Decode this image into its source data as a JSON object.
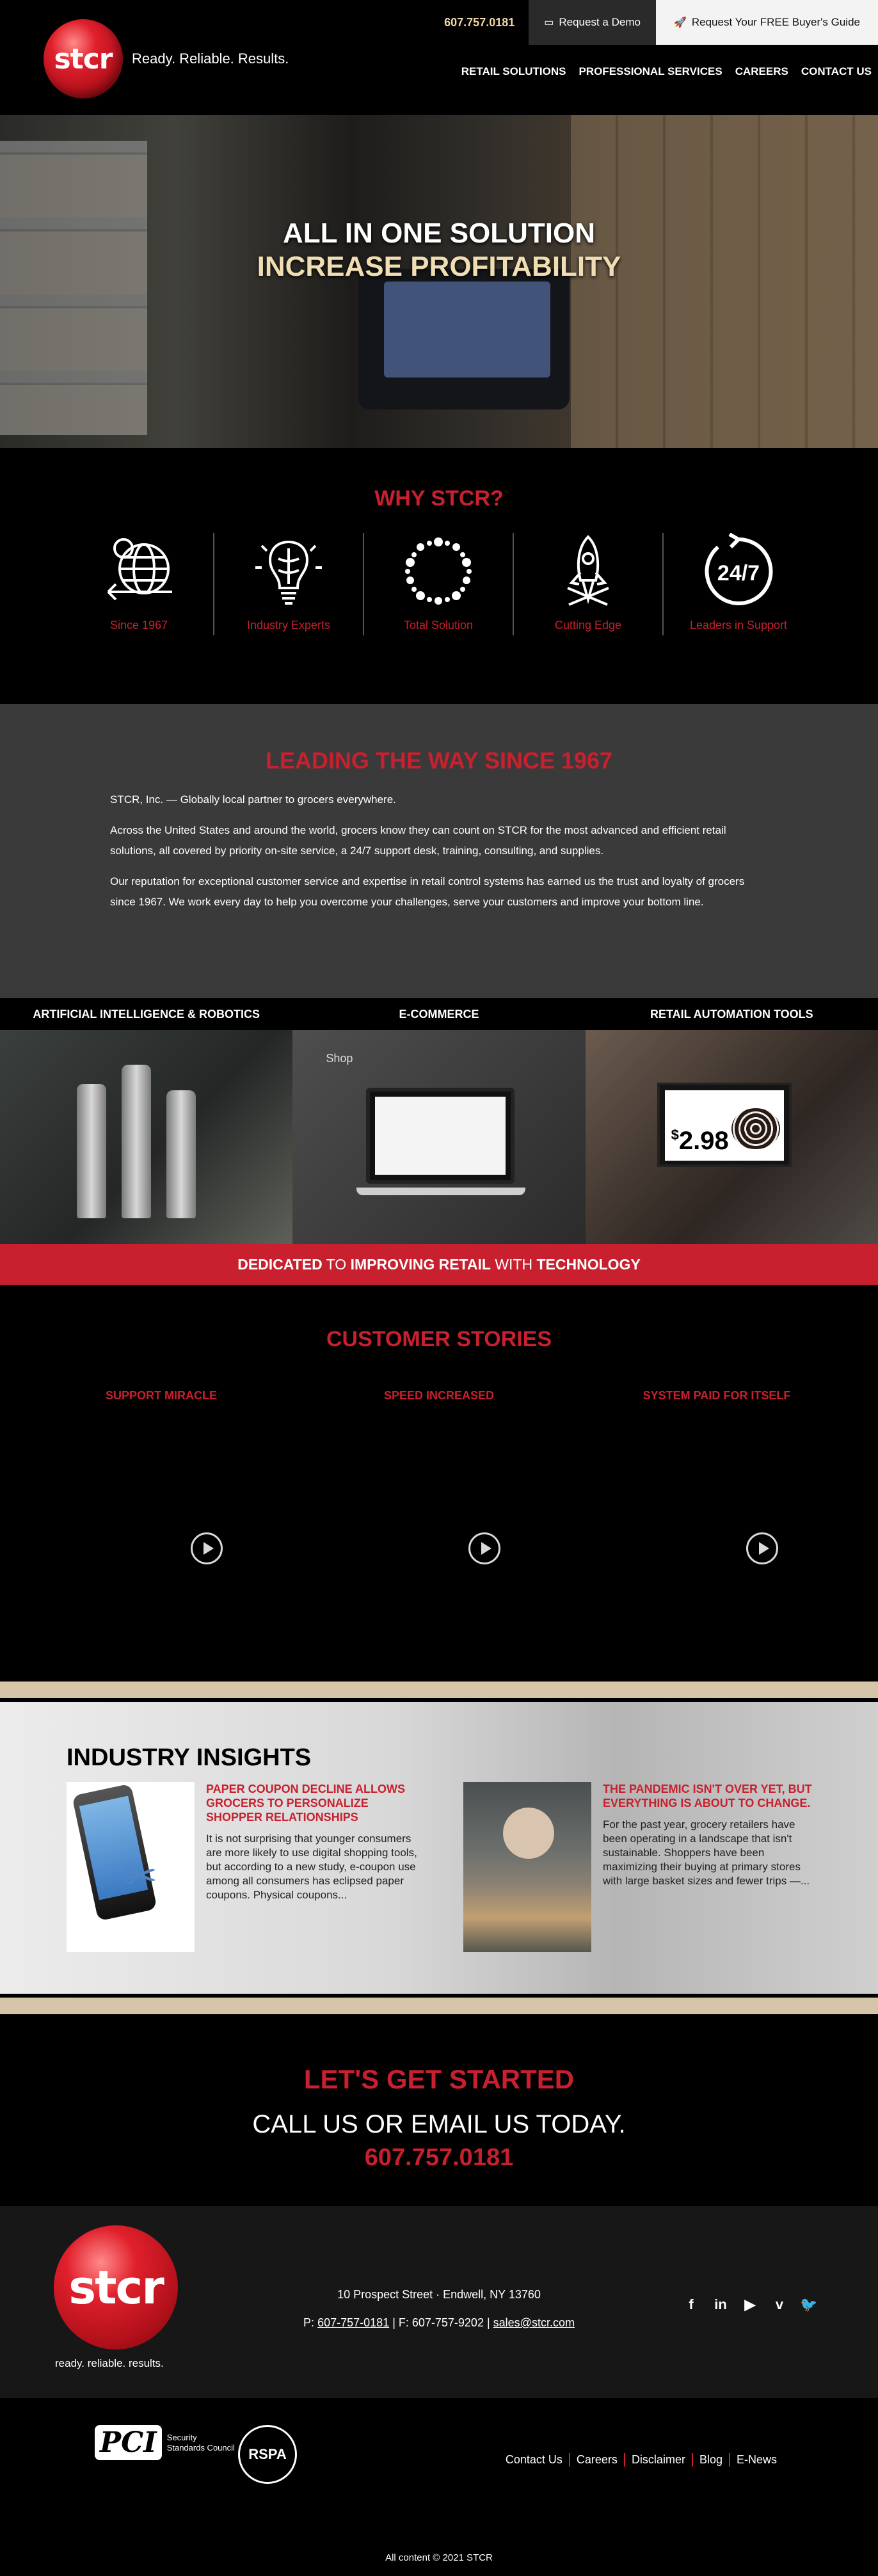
{
  "header": {
    "logo_text": "stcr",
    "tagline": "Ready. Reliable. Results.",
    "phone": "607.757.0181",
    "demo_label": "Request a Demo",
    "guide_label": "Request Your FREE Buyer's Guide",
    "nav": [
      "RETAIL SOLUTIONS",
      "PROFESSIONAL SERVICES",
      "CAREERS",
      "CONTACT US"
    ]
  },
  "hero": {
    "line1": "ALL IN ONE SOLUTION",
    "line2": "INCREASE PROFITABILITY"
  },
  "why": {
    "title": "WHY STCR?",
    "items": [
      {
        "label": "Since 1967",
        "icon": "globe-icon"
      },
      {
        "label": "Industry Experts",
        "icon": "lightbulb-brain-icon"
      },
      {
        "label": "Total Solution",
        "icon": "dotted-circle-icon"
      },
      {
        "label": "Cutting Edge",
        "icon": "rocket-icon"
      },
      {
        "label": "Leaders in Support",
        "icon": "24-7-icon",
        "badge": "24/7"
      }
    ]
  },
  "leading": {
    "title": "LEADING THE WAY SINCE 1967",
    "p1": "STCR, Inc. — Globally local partner to grocers everywhere.",
    "p2": "Across the United States and around the world, grocers know they can count on STCR for the most advanced and efficient retail solutions, all covered by priority on-site service, a 24/7 support desk, training, consulting, and supplies.",
    "p3": "Our reputation for exceptional customer service and expertise in retail control systems has earned us the trust and loyalty of grocers since 1967. We work every day to help you overcome your challenges, serve your customers and improve your bottom line."
  },
  "solutions": {
    "heads": [
      "ARTIFICIAL INTELLIGENCE & ROBOTICS",
      "E-COMMERCE",
      "RETAIL AUTOMATION TOOLS"
    ],
    "shop_label": "Shop",
    "tag_price": "2.98",
    "tag_currency": "$"
  },
  "dedicated": {
    "w1": "DEDICATED",
    "w2": "TO",
    "w3": "IMPROVING RETAIL",
    "w4": "WITH",
    "w5": "TECHNOLOGY"
  },
  "stories": {
    "title": "CUSTOMER STORIES",
    "items": [
      "SUPPORT MIRACLE",
      "SPEED INCREASED",
      "SYSTEM PAID FOR ITSELF"
    ]
  },
  "insights": {
    "title": "INDUSTRY INSIGHTS",
    "articles": [
      {
        "title": "PAPER COUPON DECLINE ALLOWS GROCERS TO PERSONALIZE SHOPPER RELATIONSHIPS",
        "text": "It is not surprising that younger consumers are more likely to use digital shopping tools, but according to a new study, e-coupon use among all consumers has eclipsed paper coupons. Physical coupons..."
      },
      {
        "title": "THE PANDEMIC ISN'T OVER YET, BUT EVERYTHING IS ABOUT TO CHANGE.",
        "text": "For the past year, grocery retailers have been operating in a landscape that isn't sustainable. Shoppers have been maximizing their buying at primary stores with large basket sizes and fewer trips —..."
      }
    ]
  },
  "started": {
    "title": "LET'S GET STARTED",
    "call": "CALL US OR EMAIL US TODAY.",
    "phone": "607.757.0181"
  },
  "footer": {
    "logo_text": "stcr",
    "tagline": "ready. reliable. results.",
    "address": "10 Prospect Street · Endwell, NY 13760",
    "phone_prefix": "P:",
    "phone": "607-757-0181",
    "fax": "| F: 607-757-9202 |",
    "email": "sales@stcr.com",
    "social": [
      "facebook-icon",
      "linkedin-icon",
      "youtube-icon",
      "vimeo-icon",
      "twitter-icon"
    ],
    "pci_mark": "PCI",
    "pci_text1": "Security",
    "pci_text2": "Standards Council",
    "rspa": "RSPA",
    "links": [
      "Contact Us",
      "Careers",
      "Disclaimer",
      "Blog",
      "E-News"
    ],
    "copyright": "All content © 2021 STCR"
  },
  "colors": {
    "brand_red": "#c8202e",
    "phone_tan": "#f2d7a8",
    "band_tan": "#d7c5a9"
  }
}
